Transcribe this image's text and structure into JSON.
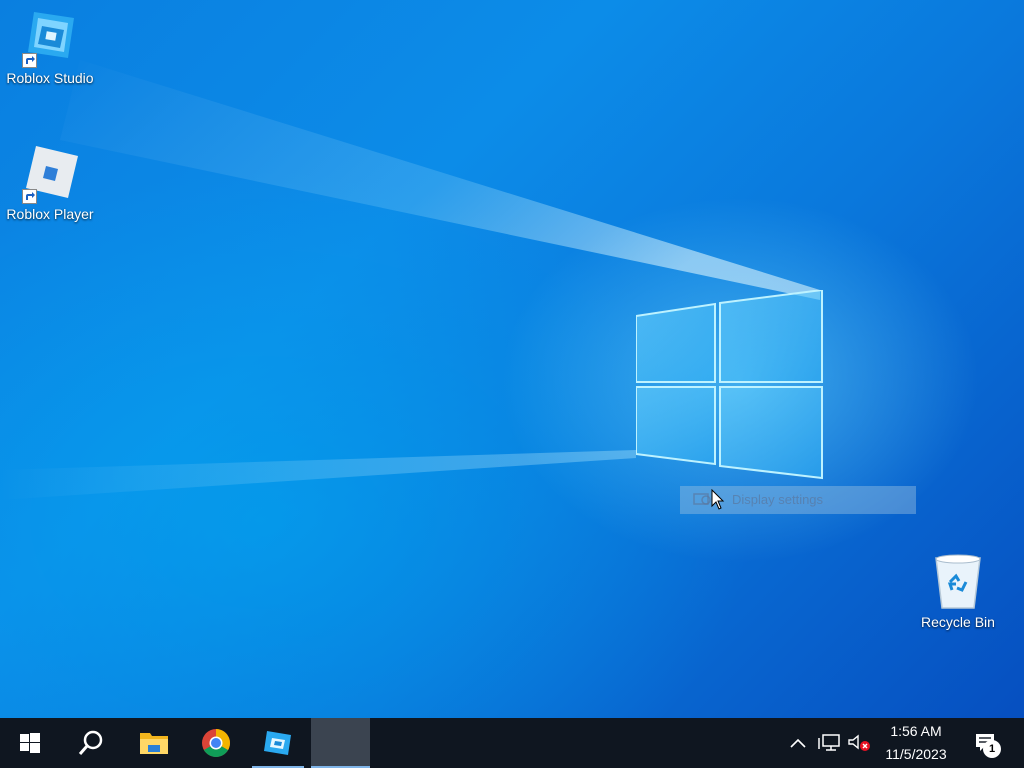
{
  "desktop": {
    "icons": [
      {
        "label": "Roblox Studio",
        "icon": "roblox-studio-icon"
      },
      {
        "label": "Roblox Player",
        "icon": "roblox-player-icon"
      },
      {
        "label": "Recycle Bin",
        "icon": "recycle-bin-icon"
      }
    ],
    "context_menu_fading": {
      "label": "Display settings",
      "icon": "display-settings-icon"
    }
  },
  "taskbar": {
    "start": {
      "icon": "windows-start-icon"
    },
    "search": {
      "icon": "search-icon"
    },
    "pinned": [
      {
        "name": "File Explorer",
        "icon": "file-explorer-icon"
      },
      {
        "name": "Google Chrome",
        "icon": "chrome-icon"
      },
      {
        "name": "Roblox Studio",
        "icon": "roblox-studio-icon",
        "active": true
      },
      {
        "name": "Open window",
        "icon": "blank-window-thumbnail",
        "active": true
      }
    ],
    "tray": {
      "overflow_icon": "chevron-up-icon",
      "network_icon": "network-icon",
      "volume_icon": "volume-muted-icon",
      "time": "1:56 AM",
      "date": "11/5/2023",
      "notifications_icon": "action-center-icon",
      "notifications_count": "1"
    }
  },
  "colors": {
    "wallpaper_base": "#0a7fe0",
    "taskbar_bg": "#0f1620",
    "active_indicator": "#7fb4e8"
  }
}
